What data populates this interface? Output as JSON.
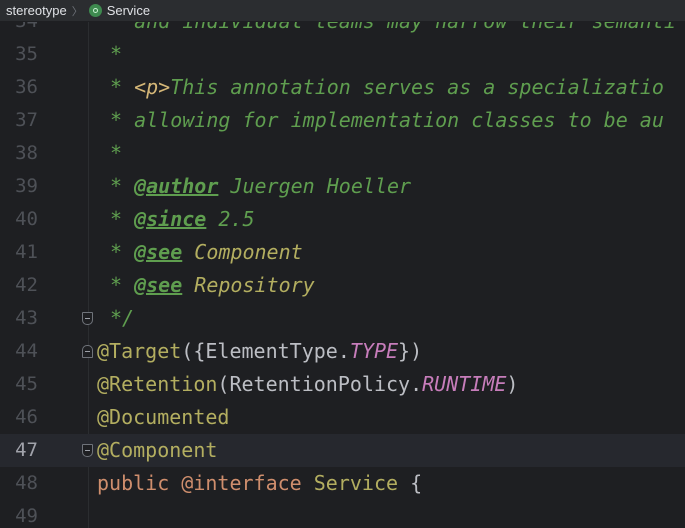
{
  "breadcrumb": {
    "package": "stereotype",
    "separator": "〉",
    "file": "Service",
    "file_icon": "spring-bean-icon"
  },
  "current_line": "47",
  "lines": [
    {
      "n": "34",
      "t": [
        "* and individual teams may narrow their semanti"
      ]
    },
    {
      "n": "35",
      "t": [
        "*"
      ]
    },
    {
      "n": "36",
      "t": [
        "* ",
        "<p>",
        "This annotation serves as a specializatio"
      ]
    },
    {
      "n": "37",
      "t": [
        "* allowing for implementation classes to be au"
      ]
    },
    {
      "n": "38",
      "t": [
        "*"
      ]
    },
    {
      "n": "39",
      "t": [
        "* ",
        "@author",
        " Juergen Hoeller"
      ]
    },
    {
      "n": "40",
      "t": [
        "* ",
        "@since",
        " 2.5"
      ]
    },
    {
      "n": "41",
      "t": [
        "* ",
        "@see",
        " Component"
      ]
    },
    {
      "n": "42",
      "t": [
        "* ",
        "@see",
        " Repository"
      ]
    },
    {
      "n": "43",
      "t": [
        "*/"
      ]
    },
    {
      "n": "44",
      "t": [
        "@Target",
        "({ElementType.",
        "TYPE",
        "})"
      ]
    },
    {
      "n": "45",
      "t": [
        "@Retention",
        "(RetentionPolicy.",
        "RUNTIME",
        ")"
      ]
    },
    {
      "n": "46",
      "t": [
        "@Documented"
      ]
    },
    {
      "n": "47",
      "t": [
        "@Component"
      ]
    },
    {
      "n": "48",
      "t": [
        "public",
        " @",
        "interface",
        " ",
        "Service",
        " {"
      ]
    },
    {
      "n": "49",
      "t": []
    }
  ]
}
